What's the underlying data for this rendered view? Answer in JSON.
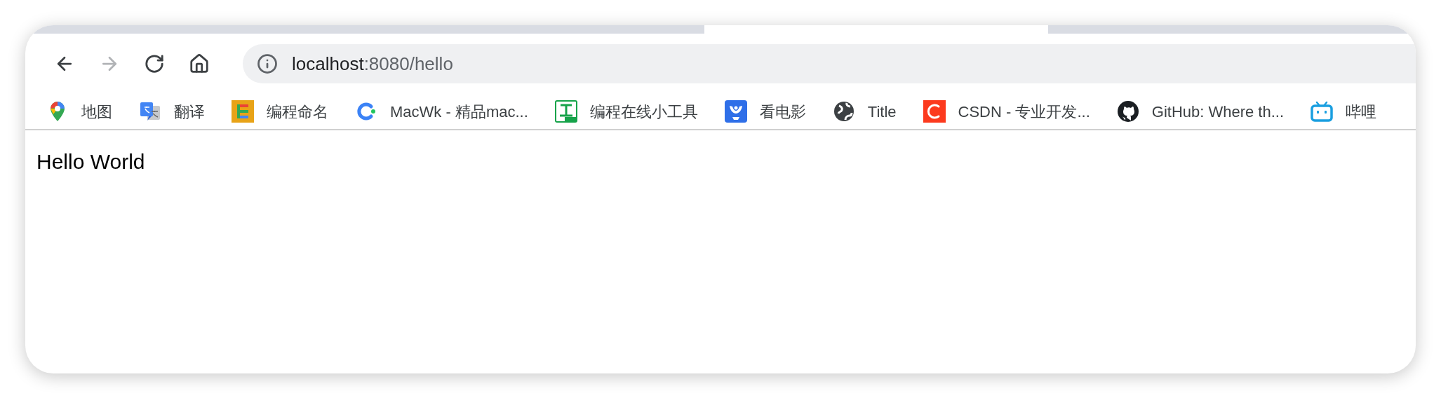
{
  "nav_buttons": [
    {
      "kind": "back",
      "disabled": false
    },
    {
      "kind": "forward",
      "disabled": true
    },
    {
      "kind": "reload",
      "disabled": false
    },
    {
      "kind": "home",
      "disabled": false
    }
  ],
  "address_bar": {
    "host": "localhost",
    "path": ":8080/hello"
  },
  "bookmarks": [
    {
      "kind": "maps",
      "label": "地图"
    },
    {
      "kind": "translate",
      "label": "翻译"
    },
    {
      "kind": "tile",
      "label": "编程命名"
    },
    {
      "kind": "c-ring",
      "label": "MacWk - 精品mac..."
    },
    {
      "kind": "web-tool",
      "label": "编程在线小工具"
    },
    {
      "kind": "video",
      "label": "看电影"
    },
    {
      "kind": "globe",
      "label": "Title"
    },
    {
      "kind": "csdn",
      "label": "CSDN - 专业开发..."
    },
    {
      "kind": "github",
      "label": "GitHub: Where th..."
    },
    {
      "kind": "tv",
      "label": "哔哩"
    }
  ],
  "page": {
    "text": "Hello World"
  }
}
